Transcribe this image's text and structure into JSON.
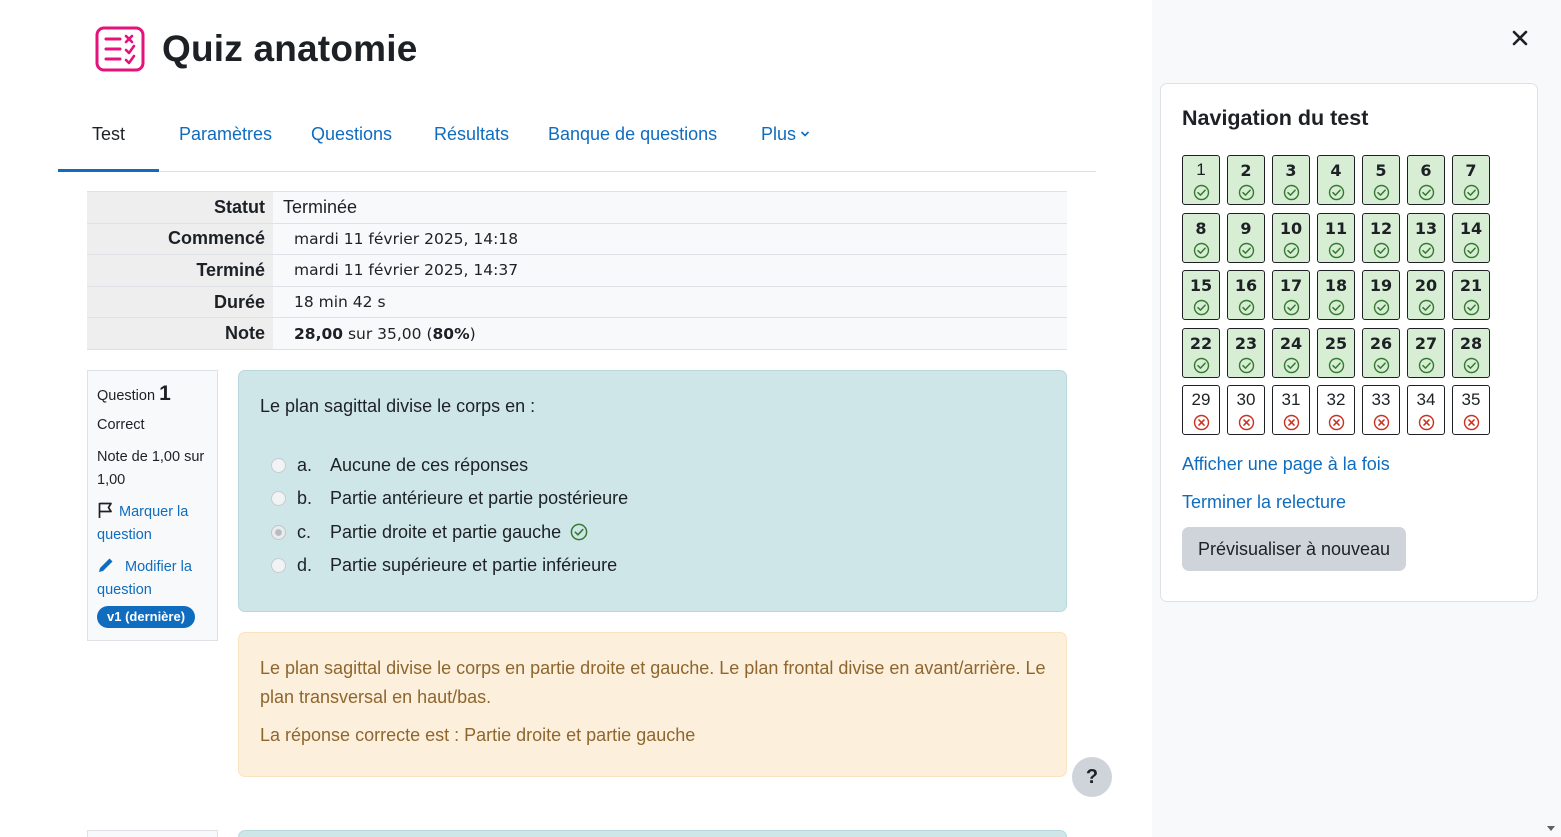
{
  "page": {
    "title": "Quiz anatomie",
    "icon": "quiz-checklist-icon",
    "accent_color": "#e6127c"
  },
  "tabs": [
    {
      "label": "Test",
      "active": true
    },
    {
      "label": "Paramètres"
    },
    {
      "label": "Questions"
    },
    {
      "label": "Résultats"
    },
    {
      "label": "Banque de questions"
    },
    {
      "label": "Plus"
    }
  ],
  "summary": {
    "status_label": "Statut",
    "status_value": "Terminée",
    "started_label": "Commencé",
    "started_value": "mardi 11 février 2025, 14:18",
    "finished_label": "Terminé",
    "finished_value": "mardi 11 février 2025, 14:37",
    "duration_label": "Durée",
    "duration_value": "18 min 42 s",
    "grade_label": "Note",
    "grade_score": "28,00",
    "grade_mid": " sur 35,00 (",
    "grade_percent": "80%",
    "grade_end": ")"
  },
  "question": {
    "prefix": "Question",
    "number": "1",
    "state": "Correct",
    "grade": "Note de 1,00 sur 1,00",
    "flag_label": "Marquer la question",
    "edit_label": "Modifier la question",
    "version_badge": "v1 (dernière)",
    "text": "Le plan sagittal divise le corps en :",
    "answers": [
      {
        "letter": "a.",
        "text": "Aucune de ces réponses",
        "selected": false
      },
      {
        "letter": "b.",
        "text": "Partie antérieure et partie postérieure",
        "selected": false
      },
      {
        "letter": "c.",
        "text": "Partie droite et partie gauche",
        "selected": true,
        "correct": true
      },
      {
        "letter": "d.",
        "text": "Partie supérieure et partie inférieure",
        "selected": false
      }
    ],
    "feedback": "Le plan sagittal divise le corps en partie droite et gauche. Le plan frontal divise en avant/arrière. Le plan transversal en haut/bas.",
    "right_answer": "La réponse correcte est : Partie droite et partie gauche"
  },
  "help_label": "?",
  "drawer": {
    "nav_title": "Navigation du test",
    "questions": [
      {
        "n": "1",
        "status": "correct"
      },
      {
        "n": "2",
        "status": "correct"
      },
      {
        "n": "3",
        "status": "correct"
      },
      {
        "n": "4",
        "status": "correct"
      },
      {
        "n": "5",
        "status": "correct"
      },
      {
        "n": "6",
        "status": "correct"
      },
      {
        "n": "7",
        "status": "correct"
      },
      {
        "n": "8",
        "status": "correct"
      },
      {
        "n": "9",
        "status": "correct"
      },
      {
        "n": "10",
        "status": "correct"
      },
      {
        "n": "11",
        "status": "correct"
      },
      {
        "n": "12",
        "status": "correct"
      },
      {
        "n": "13",
        "status": "correct"
      },
      {
        "n": "14",
        "status": "correct"
      },
      {
        "n": "15",
        "status": "correct"
      },
      {
        "n": "16",
        "status": "correct"
      },
      {
        "n": "17",
        "status": "correct"
      },
      {
        "n": "18",
        "status": "correct"
      },
      {
        "n": "19",
        "status": "correct"
      },
      {
        "n": "20",
        "status": "correct"
      },
      {
        "n": "21",
        "status": "correct"
      },
      {
        "n": "22",
        "status": "correct"
      },
      {
        "n": "23",
        "status": "correct"
      },
      {
        "n": "24",
        "status": "correct"
      },
      {
        "n": "25",
        "status": "correct"
      },
      {
        "n": "26",
        "status": "correct"
      },
      {
        "n": "27",
        "status": "correct"
      },
      {
        "n": "28",
        "status": "correct"
      },
      {
        "n": "29",
        "status": "incorrect"
      },
      {
        "n": "30",
        "status": "incorrect"
      },
      {
        "n": "31",
        "status": "incorrect"
      },
      {
        "n": "32",
        "status": "incorrect"
      },
      {
        "n": "33",
        "status": "incorrect"
      },
      {
        "n": "34",
        "status": "incorrect"
      },
      {
        "n": "35",
        "status": "incorrect"
      }
    ],
    "show_one_page": "Afficher une page à la fois",
    "finish_review": "Terminer la relecture",
    "preview_again": "Prévisualiser à nouveau"
  },
  "colors": {
    "link": "#0f6cbf",
    "correct_bg": "#d7eed4",
    "correct_icon": "#357a32",
    "incorrect_icon": "#ca3120",
    "question_bg": "#cfe6e9",
    "feedback_bg": "#fcefdc",
    "feedback_text": "#8e662e"
  }
}
